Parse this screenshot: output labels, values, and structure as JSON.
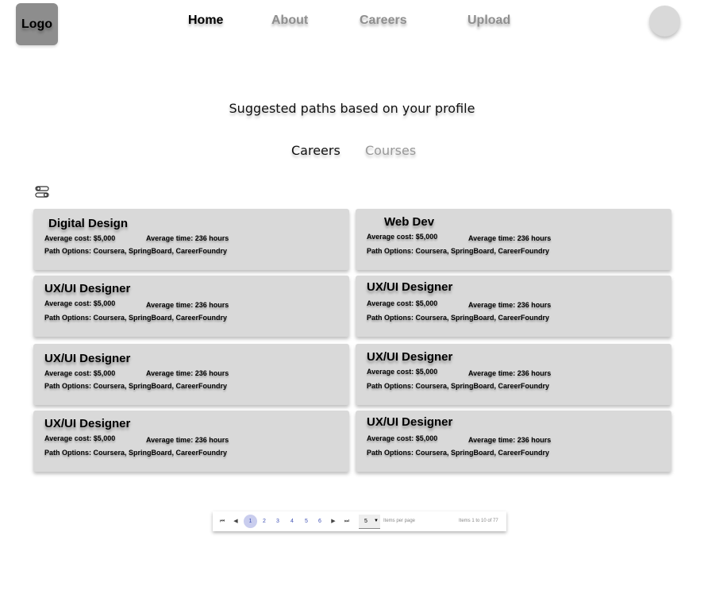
{
  "header": {
    "logo": "Logo",
    "nav": [
      {
        "label": "Home",
        "active": true
      },
      {
        "label": "About",
        "active": false
      },
      {
        "label": "Careers",
        "active": false
      },
      {
        "label": "Upload",
        "active": false
      }
    ]
  },
  "main": {
    "heading": "Suggested paths based on your profile",
    "tabs": [
      {
        "label": "Careers",
        "active": true
      },
      {
        "label": "Courses",
        "active": false
      }
    ],
    "cards": [
      {
        "title": "Digital Design",
        "cost": "Average cost: $5,000",
        "time": "Average time: 236 hours",
        "options": "Path Options: Coursera, SpringBoard, CareerFoundry"
      },
      {
        "title": "Web Dev",
        "cost": "Average cost: $5,000",
        "time": "Average time: 236 hours",
        "options": "Path Options: Coursera, SpringBoard, CareerFoundry"
      },
      {
        "title": "UX/UI Designer",
        "cost": "Average cost: $5,000",
        "time": "Average time: 236 hours",
        "options": "Path Options: Coursera, SpringBoard, CareerFoundry"
      },
      {
        "title": "UX/UI Designer",
        "cost": "Average cost: $5,000",
        "time": "Average time: 236 hours",
        "options": "Path Options: Coursera, SpringBoard, CareerFoundry"
      },
      {
        "title": "UX/UI Designer",
        "cost": "Average cost: $5,000",
        "time": "Average time: 236 hours",
        "options": "Path Options: Coursera, SpringBoard, CareerFoundry"
      },
      {
        "title": "UX/UI Designer",
        "cost": "Average cost: $5,000",
        "time": "Average time: 236 hours",
        "options": "Path Options: Coursera, SpringBoard, CareerFoundry"
      },
      {
        "title": "UX/UI Designer",
        "cost": "Average cost: $5,000",
        "time": "Average time: 236 hours",
        "options": "Path Options: Coursera, SpringBoard, CareerFoundry"
      },
      {
        "title": "UX/UI Designer",
        "cost": "Average cost: $5,000",
        "time": "Average time: 236 hours",
        "options": "Path Options: Coursera, SpringBoard, CareerFoundry"
      }
    ]
  },
  "pagination": {
    "first": "⏮",
    "prev": "◀",
    "pages": [
      "1",
      "2",
      "3",
      "4",
      "5",
      "6"
    ],
    "current": "1",
    "next": "▶",
    "last": "⏭",
    "per_page_value": "5",
    "per_page_label": "Items per page",
    "range_text": "Items 1 to 10 of 77"
  },
  "icons": {
    "filter": "filter-toggle-icon"
  },
  "colors": {
    "card_bg": "#d9d9d9",
    "logo_bg": "#8d8d8d",
    "inactive_text": "#8f8f8f",
    "pager_accent": "#3f51b5",
    "pager_current_bg": "#c9cdee"
  }
}
